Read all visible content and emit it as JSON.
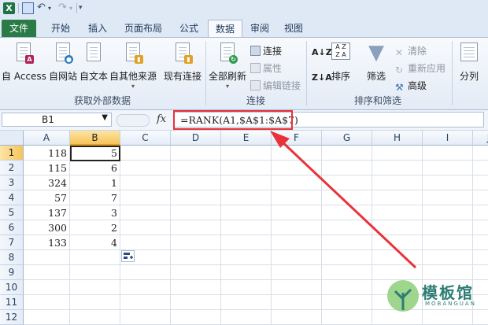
{
  "qat": {
    "logo": "X"
  },
  "tabs": [
    "文件",
    "开始",
    "插入",
    "页面布局",
    "公式",
    "数据",
    "审阅",
    "视图"
  ],
  "active_tab": "数据",
  "ribbon": {
    "external": {
      "buttons": [
        "自 Access",
        "自网站",
        "自文本",
        "自其他来源",
        "现有连接"
      ],
      "group_label": "获取外部数据"
    },
    "connections": {
      "refresh_label": "全部刷新",
      "items": [
        "连接",
        "属性",
        "编辑链接"
      ],
      "group_label": "连接"
    },
    "sort_filter": {
      "sort_label": "排序",
      "filter_label": "筛选",
      "items": [
        "清除",
        "重新应用",
        "高级"
      ],
      "group_label": "排序和筛选"
    },
    "tools": {
      "split_label": "分列"
    }
  },
  "formula_bar": {
    "name_box": "B1",
    "fx_label": "fx",
    "formula": "=RANK(A1,$A$1:$A$7)"
  },
  "columns": [
    "A",
    "B",
    "C",
    "D",
    "E",
    "F",
    "G",
    "H",
    "I",
    "J"
  ],
  "rows": [
    "1",
    "2",
    "3",
    "4",
    "5",
    "6",
    "7",
    "8",
    "9",
    "10",
    "11",
    "12"
  ],
  "data": {
    "A": [
      "118",
      "115",
      "324",
      "57",
      "137",
      "300",
      "133"
    ],
    "B": [
      "5",
      "6",
      "1",
      "7",
      "3",
      "2",
      "4"
    ]
  },
  "watermark": {
    "text": "模板馆",
    "sub": "MOBANGUAN"
  },
  "colors": {
    "accent_red": "#e8333a",
    "file_tab": "#2a7b46",
    "selection": "#f7c45a"
  }
}
